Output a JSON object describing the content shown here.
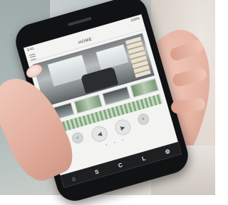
{
  "app": {
    "status_time": "3:41",
    "status_battery": "100%",
    "screen_title": "HOME"
  },
  "controls": {
    "rewind_icon": "rewind-icon",
    "prev_icon": "play-back-icon",
    "play_icon": "play-icon",
    "forward_icon": "fast-forward-icon"
  },
  "tabbar": {
    "tab1": "⌂",
    "tab2": "S",
    "tab3": "C",
    "tab4": "L",
    "tab5": "⚙"
  },
  "colors": {
    "phone_body": "#101214",
    "timeline_green": "#7ea27b",
    "tabbar_bg": "#1d1f21"
  }
}
